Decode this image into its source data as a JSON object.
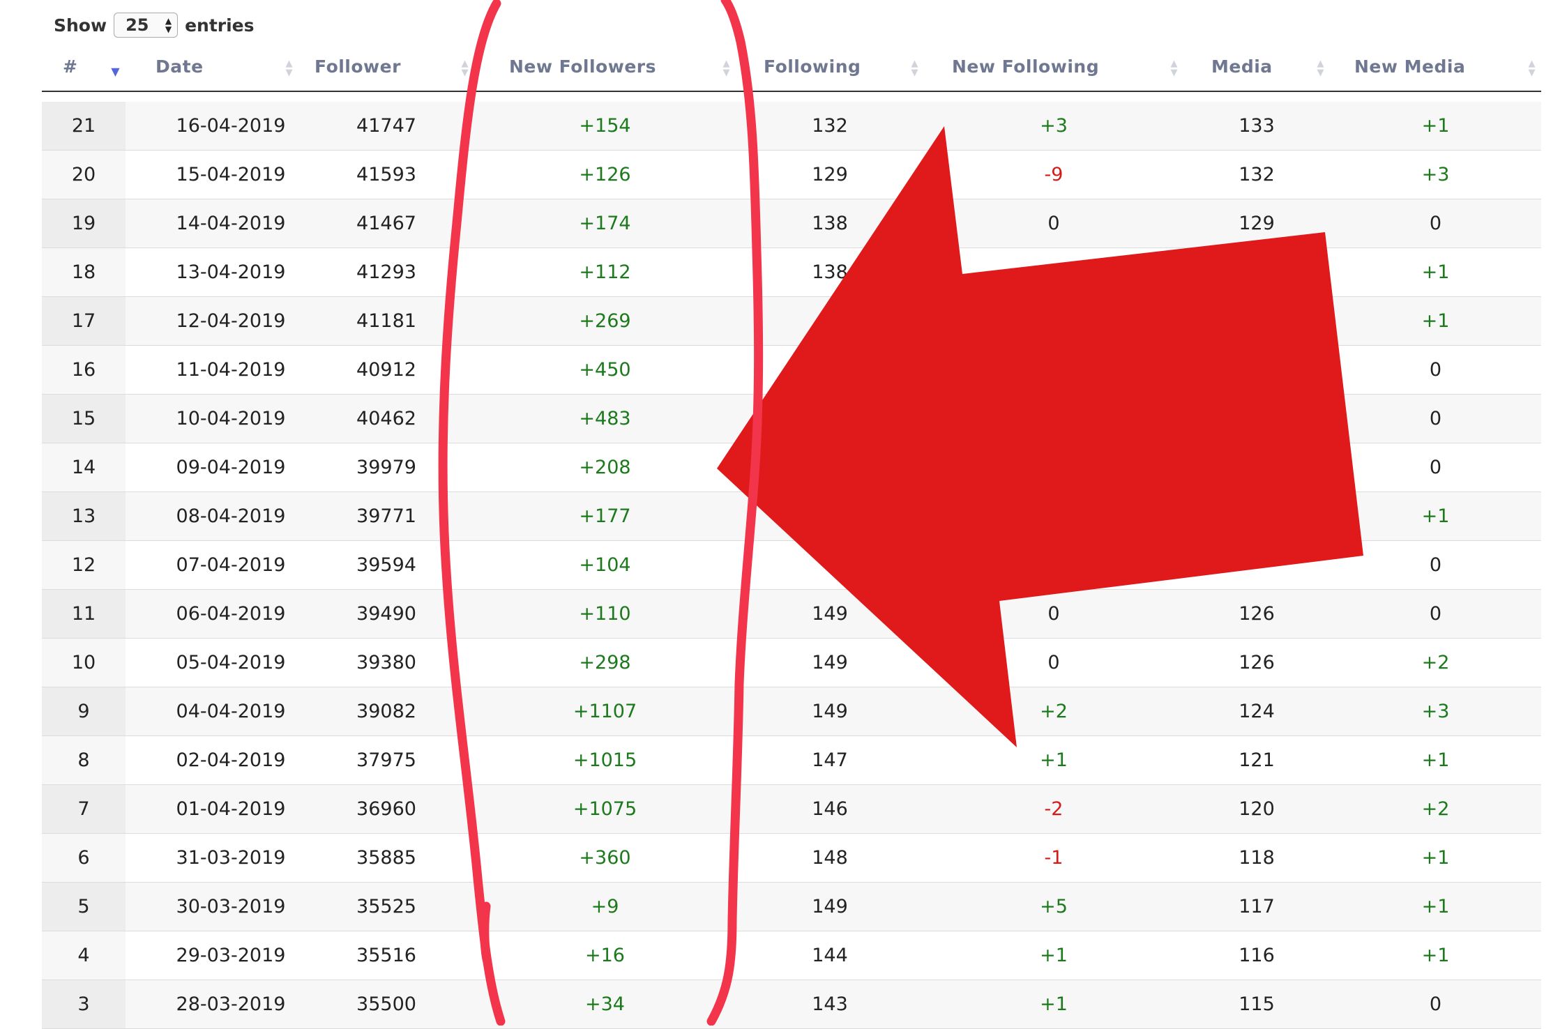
{
  "length_menu": {
    "show_label": "Show",
    "value": "25",
    "entries_label": "entries"
  },
  "columns": [
    {
      "key": "num",
      "label": "#"
    },
    {
      "key": "date",
      "label": "Date"
    },
    {
      "key": "follower",
      "label": "Follower"
    },
    {
      "key": "new_followers",
      "label": "New Followers"
    },
    {
      "key": "following",
      "label": "Following"
    },
    {
      "key": "new_following",
      "label": "New Following"
    },
    {
      "key": "media",
      "label": "Media"
    },
    {
      "key": "new_media",
      "label": "New Media"
    }
  ],
  "rows": [
    {
      "num": "21",
      "date": "16-04-2019",
      "follower": "41747",
      "new_followers": "+154",
      "following": "132",
      "new_following": "+3",
      "media": "133",
      "new_media": "+1"
    },
    {
      "num": "20",
      "date": "15-04-2019",
      "follower": "41593",
      "new_followers": "+126",
      "following": "129",
      "new_following": "-9",
      "media": "132",
      "new_media": "+3"
    },
    {
      "num": "19",
      "date": "14-04-2019",
      "follower": "41467",
      "new_followers": "+174",
      "following": "138",
      "new_following": "0",
      "media": "129",
      "new_media": "0"
    },
    {
      "num": "18",
      "date": "13-04-2019",
      "follower": "41293",
      "new_followers": "+112",
      "following": "138",
      "new_following": "",
      "media": "",
      "new_media": "+1"
    },
    {
      "num": "17",
      "date": "12-04-2019",
      "follower": "41181",
      "new_followers": "+269",
      "following": "",
      "new_following": "",
      "media": "",
      "new_media": "+1"
    },
    {
      "num": "16",
      "date": "11-04-2019",
      "follower": "40912",
      "new_followers": "+450",
      "following": "",
      "new_following": "",
      "media": "",
      "new_media": "0"
    },
    {
      "num": "15",
      "date": "10-04-2019",
      "follower": "40462",
      "new_followers": "+483",
      "following": "",
      "new_following": "",
      "media": "",
      "new_media": "0"
    },
    {
      "num": "14",
      "date": "09-04-2019",
      "follower": "39979",
      "new_followers": "+208",
      "following": "",
      "new_following": "",
      "media": "",
      "new_media": "0"
    },
    {
      "num": "13",
      "date": "08-04-2019",
      "follower": "39771",
      "new_followers": "+177",
      "following": "",
      "new_following": "",
      "media": "",
      "new_media": "+1"
    },
    {
      "num": "12",
      "date": "07-04-2019",
      "follower": "39594",
      "new_followers": "+104",
      "following": "",
      "new_following": "",
      "media": "",
      "new_media": "0"
    },
    {
      "num": "11",
      "date": "06-04-2019",
      "follower": "39490",
      "new_followers": "+110",
      "following": "149",
      "new_following": "0",
      "media": "126",
      "new_media": "0"
    },
    {
      "num": "10",
      "date": "05-04-2019",
      "follower": "39380",
      "new_followers": "+298",
      "following": "149",
      "new_following": "0",
      "media": "126",
      "new_media": "+2"
    },
    {
      "num": "9",
      "date": "04-04-2019",
      "follower": "39082",
      "new_followers": "+1107",
      "following": "149",
      "new_following": "+2",
      "media": "124",
      "new_media": "+3"
    },
    {
      "num": "8",
      "date": "02-04-2019",
      "follower": "37975",
      "new_followers": "+1015",
      "following": "147",
      "new_following": "+1",
      "media": "121",
      "new_media": "+1"
    },
    {
      "num": "7",
      "date": "01-04-2019",
      "follower": "36960",
      "new_followers": "+1075",
      "following": "146",
      "new_following": "-2",
      "media": "120",
      "new_media": "+2"
    },
    {
      "num": "6",
      "date": "31-03-2019",
      "follower": "35885",
      "new_followers": "+360",
      "following": "148",
      "new_following": "-1",
      "media": "118",
      "new_media": "+1"
    },
    {
      "num": "5",
      "date": "30-03-2019",
      "follower": "35525",
      "new_followers": "+9",
      "following": "149",
      "new_following": "+5",
      "media": "117",
      "new_media": "+1"
    },
    {
      "num": "4",
      "date": "29-03-2019",
      "follower": "35516",
      "new_followers": "+16",
      "following": "144",
      "new_following": "+1",
      "media": "116",
      "new_media": "+1"
    },
    {
      "num": "3",
      "date": "28-03-2019",
      "follower": "35500",
      "new_followers": "+34",
      "following": "143",
      "new_following": "+1",
      "media": "115",
      "new_media": "0"
    }
  ],
  "colors": {
    "positive": "#1c7a1c",
    "negative": "#d51a1a",
    "header_text": "#6f7890",
    "sort_active": "#5566d6",
    "annotation_outline": "#f2354a",
    "annotation_arrow": "#e0191b"
  },
  "icons": {
    "sort_active": "sort-descending-icon",
    "sort_idle": "sort-both-icon",
    "select": "select-spinner-icon"
  }
}
